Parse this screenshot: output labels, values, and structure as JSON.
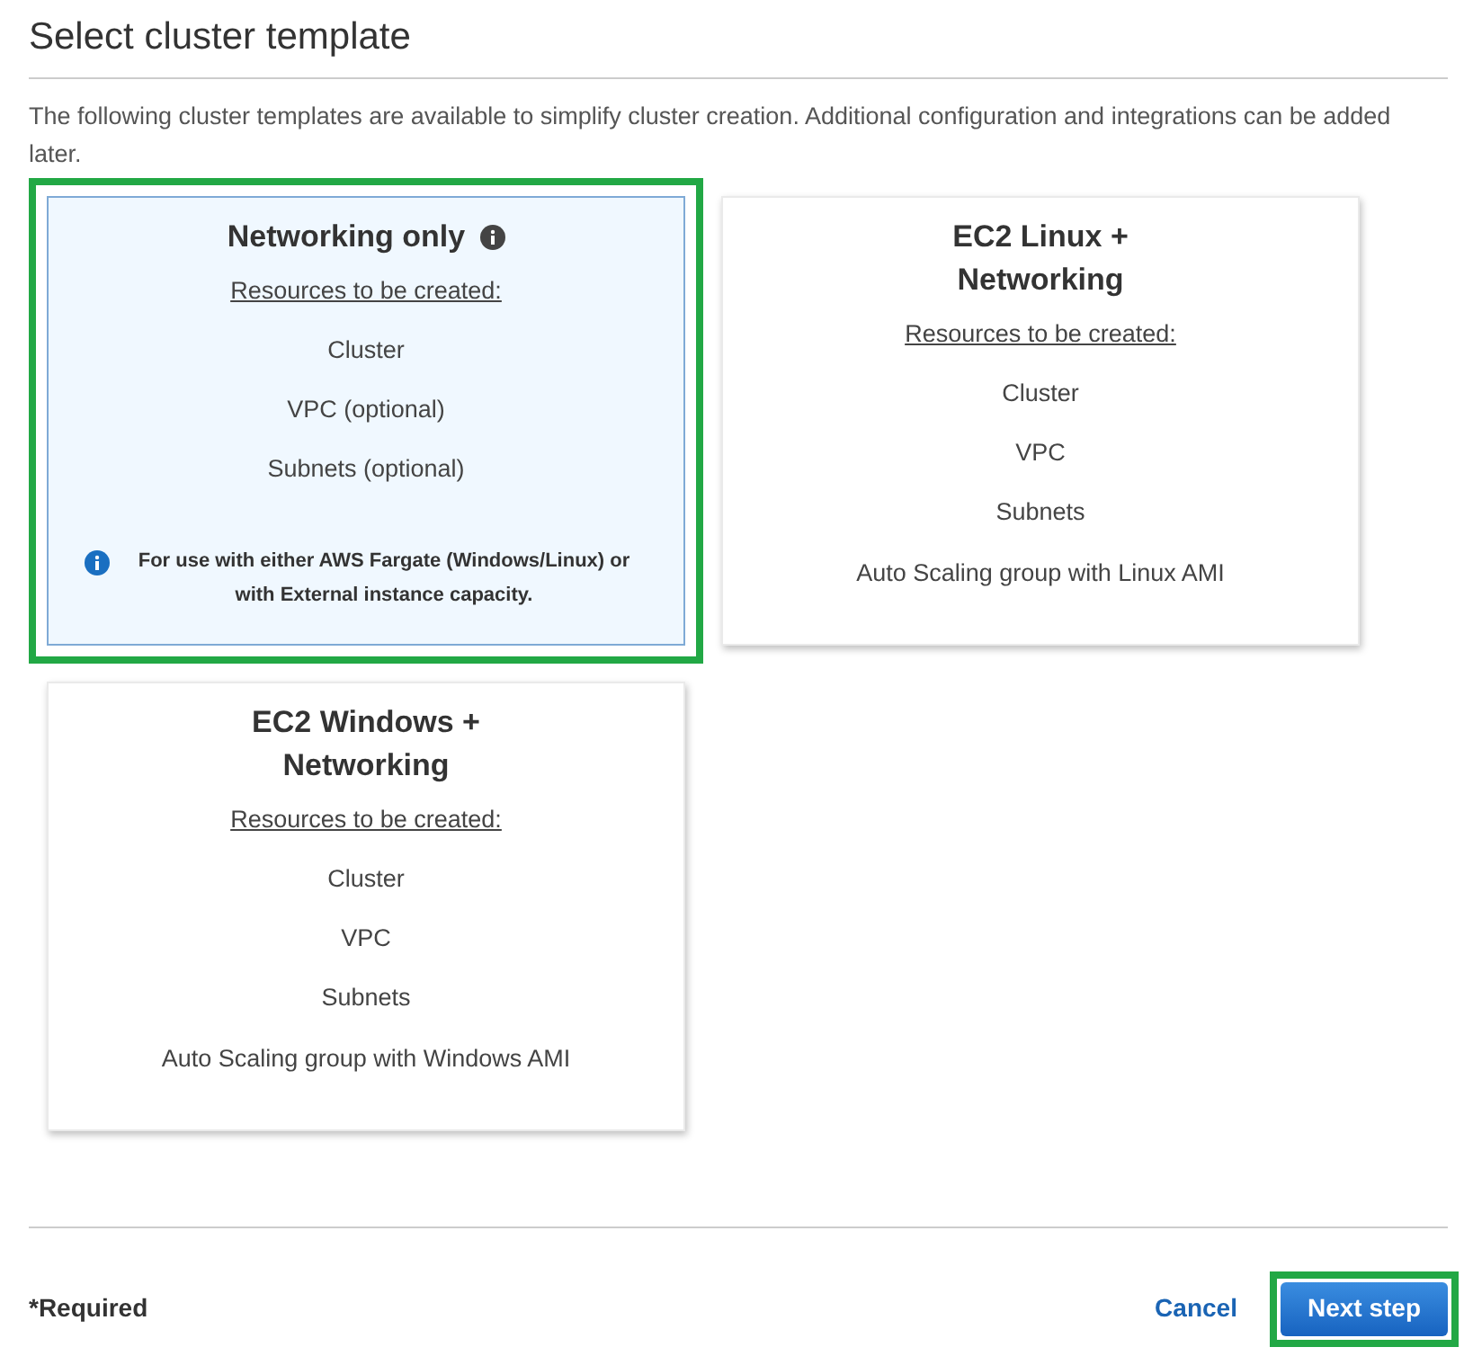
{
  "title": "Select cluster template",
  "description": "The following cluster templates are available to simplify cluster creation. Additional configuration and integrations can be added later.",
  "cards": [
    {
      "title": "Networking only",
      "info_icon": true,
      "selected": true,
      "highlighted": true,
      "resources_label": "Resources to be created:",
      "resources": [
        "Cluster",
        "VPC (optional)",
        "Subnets (optional)"
      ],
      "note": "For use with either AWS Fargate (Windows/Linux) or with External instance capacity."
    },
    {
      "title": "EC2 Linux + Networking",
      "info_icon": false,
      "selected": false,
      "highlighted": false,
      "resources_label": "Resources to be created:",
      "resources": [
        "Cluster",
        "VPC",
        "Subnets",
        "Auto Scaling group with Linux AMI"
      ]
    },
    {
      "title": "EC2 Windows + Networking",
      "info_icon": false,
      "selected": false,
      "highlighted": false,
      "resources_label": "Resources to be created:",
      "resources": [
        "Cluster",
        "VPC",
        "Subnets",
        "Auto Scaling group with Windows AMI"
      ]
    }
  ],
  "footer": {
    "required": "*Required",
    "cancel": "Cancel",
    "next": {
      "label": "Next step",
      "highlighted": true
    }
  }
}
